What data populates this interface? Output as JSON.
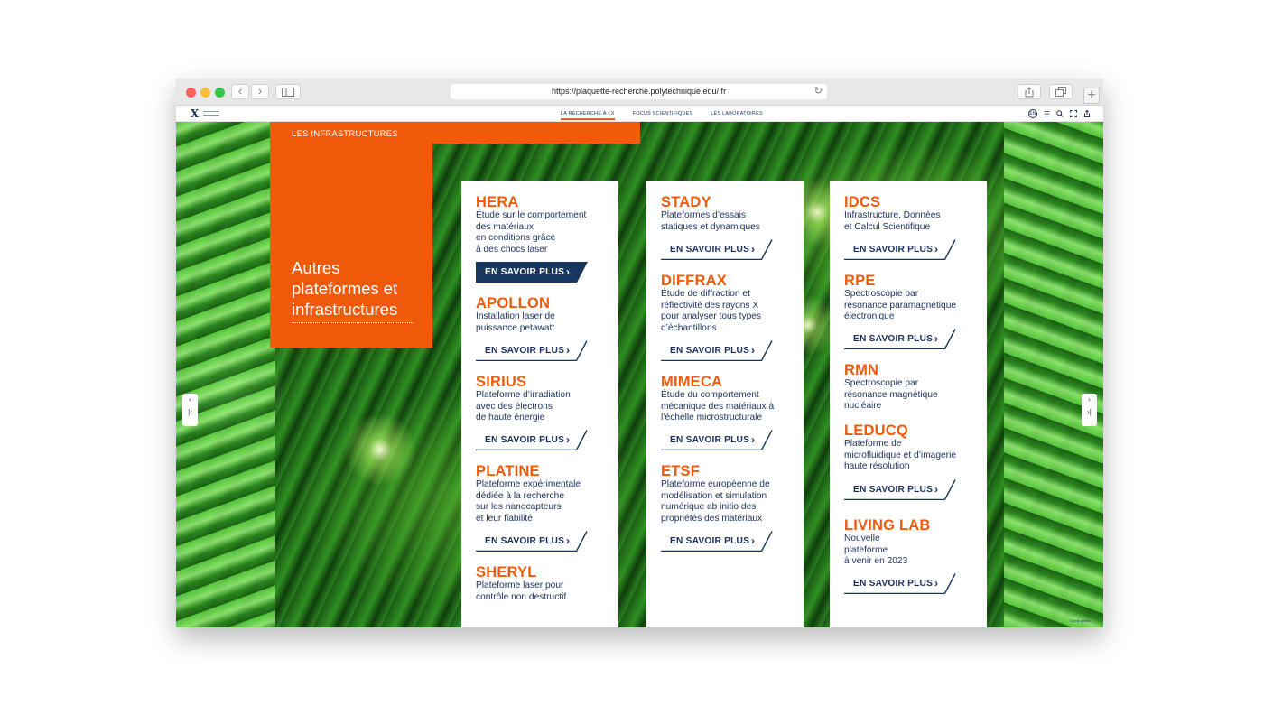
{
  "browser": {
    "url": "https://plaquette-recherche.polytechnique.edu/.fr",
    "back_symbol": "‹",
    "forward_symbol": "›",
    "reload_symbol": "↻",
    "new_tab_symbol": "+"
  },
  "site_nav": {
    "logo": "X",
    "links": [
      "LA RECHERCHE À LX",
      "FOCUS SCIENTIFIQUES",
      "LES LABORATOIRES"
    ],
    "active_index": 0,
    "lang": "EN",
    "icons": [
      "menu-icon",
      "search-icon",
      "fullscreen-icon",
      "share-icon"
    ]
  },
  "section": {
    "label": "LES INFRASTRUCTURES",
    "title": "Autres plateformes et infrastructures"
  },
  "button_label": "EN SAVOIR PLUS",
  "columns": [
    {
      "entries": [
        {
          "name": "HERA",
          "desc": "Étude sur le comportement\ndes matériaux\nen conditions grâce\nà des chocs laser",
          "button": "EN SAVOIR PLUS",
          "filled": true
        },
        {
          "name": "APOLLON",
          "desc": "Installation laser de\npuissance petawatt",
          "button": "EN SAVOIR PLUS",
          "filled": false
        },
        {
          "name": "SIRIUS",
          "desc": "Plateforme d’irradiation\navec des électrons\nde haute énergie",
          "button": "EN SAVOIR PLUS",
          "filled": false
        },
        {
          "name": "PLATINE",
          "desc": "Plateforme expérimentale\ndédiée à la recherche\nsur les nanocapteurs\net leur fiabilité",
          "button": "EN SAVOIR PLUS",
          "filled": false
        },
        {
          "name": "SHERYL",
          "desc": "Plateforme laser pour\ncontrôle non destructif",
          "button": "",
          "filled": false
        }
      ]
    },
    {
      "entries": [
        {
          "name": "STADY",
          "desc": "Plateformes d’essais\nstatiques et dynamiques",
          "button": "EN SAVOIR PLUS",
          "filled": false
        },
        {
          "name": "DIFFRAX",
          "desc": "Étude de diffraction et\nréflectivité des rayons X\npour analyser tous types\nd’échantillons",
          "button": "EN SAVOIR PLUS",
          "filled": false
        },
        {
          "name": "MIMECA",
          "desc": "Étude du comportement\nmécanique des matériaux à\nl’échelle microstructurale",
          "button": "EN SAVOIR PLUS",
          "filled": false
        },
        {
          "name": "ETSF",
          "desc": "Plateforme européenne de\nmodélisation et simulation\nnumérique ab initio des\npropriétés des matériaux",
          "button": "EN SAVOIR PLUS",
          "filled": false
        }
      ]
    },
    {
      "entries": [
        {
          "name": "IDCS",
          "desc": "Infrastructure, Données\net Calcul Scientifique",
          "button": "EN SAVOIR PLUS",
          "filled": false
        },
        {
          "name": "RPE",
          "desc": "Spectroscopie par\nrésonance paramagnétique\nélectronique",
          "button": "EN SAVOIR PLUS",
          "filled": false
        },
        {
          "name": "RMN",
          "desc": "Spectroscopie par\nrésonance magnétique\nnucléaire",
          "button": "",
          "filled": false
        },
        {
          "name": "LEDUCQ",
          "desc": "Plateforme de\nmicrofluidique et d’imagerie\nhaute résolution",
          "button": "EN SAVOIR PLUS",
          "filled": false
        },
        {
          "name": "LIVING LAB",
          "desc": "Nouvelle\nplateforme\nà venir en 2023",
          "button": "EN SAVOIR PLUS",
          "filled": false
        }
      ]
    }
  ],
  "pager": {
    "prev_symbol": "‹",
    "first_symbol": "|‹",
    "next_symbol": "›",
    "last_symbol": "›|"
  },
  "credit": "Crédit photo",
  "colors": {
    "accent": "#f05a0a",
    "navy": "#1b2f5c",
    "button_fill": "#17375e"
  }
}
